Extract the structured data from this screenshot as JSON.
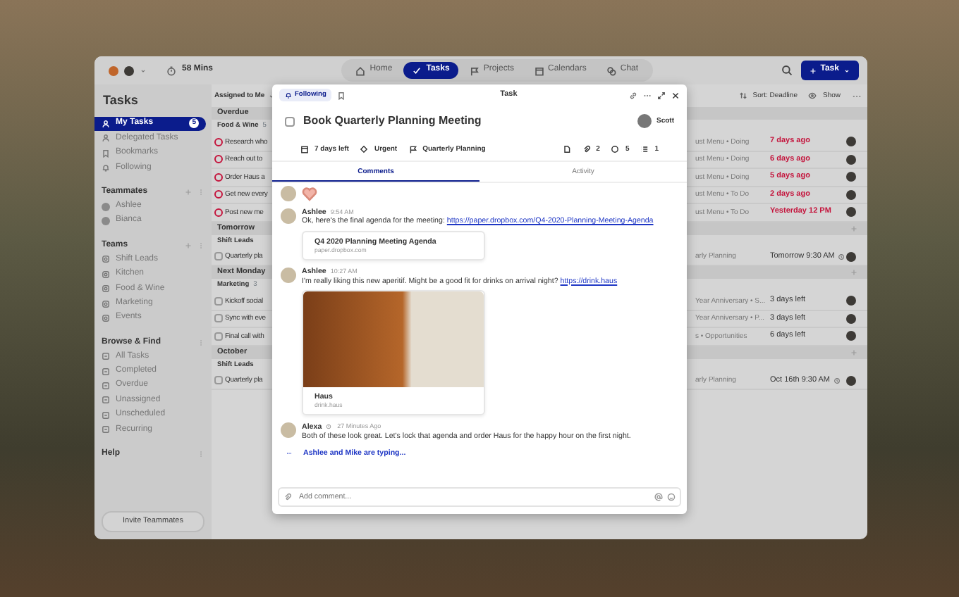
{
  "top_bar": {
    "timer": "58 Mins",
    "nav": [
      {
        "label": "Home",
        "kind": "home",
        "selected": false
      },
      {
        "label": "Tasks",
        "kind": "tasks",
        "selected": true
      },
      {
        "label": "Projects",
        "kind": "projects",
        "selected": false
      },
      {
        "label": "Calendars",
        "kind": "calendars",
        "selected": false
      },
      {
        "label": "Chat",
        "kind": "chat",
        "selected": false
      }
    ],
    "new_task_button": "Task"
  },
  "sidebar": {
    "title": "Tasks",
    "sections": [
      {
        "kind": "nav",
        "items": [
          {
            "label": "My Tasks",
            "selected": true,
            "badge": "5"
          },
          {
            "label": "Delegated Tasks",
            "selected": false
          },
          {
            "label": "Bookmarks",
            "selected": false
          },
          {
            "label": "Following",
            "selected": false
          }
        ]
      },
      {
        "kind": "people",
        "heading": "Teammates",
        "can_add": true,
        "items": [
          {
            "label": "Ashlee",
            "selected": false
          },
          {
            "label": "Bianca",
            "selected": false
          }
        ]
      },
      {
        "kind": "teams",
        "heading": "Teams",
        "can_add": true,
        "items": [
          {
            "label": "Shift Leads",
            "selected": false
          },
          {
            "label": "Kitchen",
            "selected": false
          },
          {
            "label": "Food & Wine",
            "selected": false
          },
          {
            "label": "Marketing",
            "selected": false
          },
          {
            "label": "Events",
            "selected": false
          }
        ]
      },
      {
        "kind": "filters",
        "heading": "Browse & Find",
        "can_add": false,
        "items": [
          {
            "label": "All Tasks",
            "selected": false
          },
          {
            "label": "Completed",
            "selected": false
          },
          {
            "label": "Overdue",
            "selected": false
          },
          {
            "label": "Unassigned",
            "selected": false
          },
          {
            "label": "Unscheduled",
            "selected": false
          },
          {
            "label": "Recurring",
            "selected": false
          }
        ]
      },
      {
        "heading": "Help",
        "can_add": false
      }
    ],
    "invite_button": "Invite Teammates"
  },
  "list": {
    "title": "Assigned to Me",
    "sort": "Sort: Deadline",
    "show": "Show",
    "groups": [
      {
        "label": "Overdue",
        "has_add": false,
        "subgroups": [
          {
            "label": "Food & Wine",
            "count": "5",
            "tasks": [
              {
                "title": "Research who",
                "meta": "ust Menu • Doing",
                "due": "7 days ago",
                "overdue": true,
                "recurring": false
              },
              {
                "title": "Reach out to",
                "meta": "ust Menu • Doing",
                "due": "6 days ago",
                "overdue": true,
                "recurring": false
              },
              {
                "title": "Order Haus a",
                "meta": "ust Menu • Doing",
                "due": "5 days ago",
                "overdue": true,
                "recurring": false
              },
              {
                "title": "Get new every",
                "meta": "ust Menu • To Do",
                "due": "2 days ago",
                "overdue": true,
                "recurring": false
              },
              {
                "title": "Post new me",
                "meta": "ust Menu • To Do",
                "due": "Yesterday 12 PM",
                "overdue": true,
                "recurring": false
              }
            ]
          }
        ]
      },
      {
        "label": "Tomorrow",
        "has_add": true,
        "subgroups": [
          {
            "label": "Shift Leads",
            "tasks": [
              {
                "title": "Quarterly pla",
                "meta": "arly Planning",
                "due": "Tomorrow 9:30 AM",
                "overdue": false,
                "recurring": true
              }
            ]
          }
        ]
      },
      {
        "label": "Next Monday",
        "has_add": true,
        "subgroups": [
          {
            "label": "Marketing",
            "count": "3",
            "tasks": [
              {
                "title": "Kickoff social",
                "meta": "Year Anniversary • S...",
                "due": "3 days left",
                "overdue": false,
                "recurring": false
              },
              {
                "title": "Sync with eve",
                "meta": "Year Anniversary • P...",
                "due": "3 days left",
                "overdue": false,
                "recurring": false
              },
              {
                "title": "Final call with",
                "meta": "s • Opportunities",
                "due": "6 days left",
                "overdue": false,
                "recurring": false
              }
            ]
          }
        ]
      },
      {
        "label": "October",
        "has_add": true,
        "subgroups": [
          {
            "label": "Shift Leads",
            "tasks": [
              {
                "title": "Quarterly pla",
                "meta": "arly Planning",
                "due": "Oct 16th 9:30 AM",
                "overdue": false,
                "recurring": true
              }
            ]
          }
        ]
      }
    ]
  },
  "task_panel": {
    "following_button": "Following",
    "title": "Task",
    "task_name": "Book Quarterly Planning Meeting",
    "completed": false,
    "assignee": "Scott",
    "meta": [
      {
        "kind": "deadline",
        "label": "7 days left"
      },
      {
        "kind": "priority",
        "label": "Urgent"
      },
      {
        "kind": "project",
        "label": "Quarterly Planning"
      }
    ],
    "counts": [
      {
        "kind": "attachments",
        "label": "2"
      },
      {
        "kind": "comments",
        "label": "5"
      },
      {
        "kind": "subtasks",
        "label": "1"
      }
    ],
    "tabs": [
      {
        "label": "Comments",
        "selected": true
      },
      {
        "label": "Activity",
        "selected": false
      }
    ],
    "comments": [
      {
        "kind": "emoji"
      },
      {
        "kind": "text",
        "author": "Ashlee",
        "time": "9:54 AM",
        "text": "Ok, here's the final agenda for the meeting:",
        "link": "https://paper.dropbox.com/Q4-2020-Planning-Meeting-Agenda",
        "preview": {
          "title": "Q4 2020 Planning Meeting Agenda",
          "domain": "paper.dropbox.com",
          "image": false
        }
      },
      {
        "kind": "text",
        "author": "Ashlee",
        "time": "10:27 AM",
        "text": "I'm really liking this new aperitif. Might be a good fit for drinks on arrival night?",
        "link": "https://drink.haus",
        "preview": {
          "title": "Haus",
          "domain": "drink.haus",
          "image": true
        }
      },
      {
        "kind": "text",
        "author": "Alexa",
        "time": "27 Minutes Ago",
        "text": "Both of these look great. Let's lock that agenda and order Haus for the happy hour on the first night."
      }
    ],
    "typing": "Ashlee and Mike are typing...",
    "comment_field": {
      "placeholder": "Add comment..."
    }
  }
}
